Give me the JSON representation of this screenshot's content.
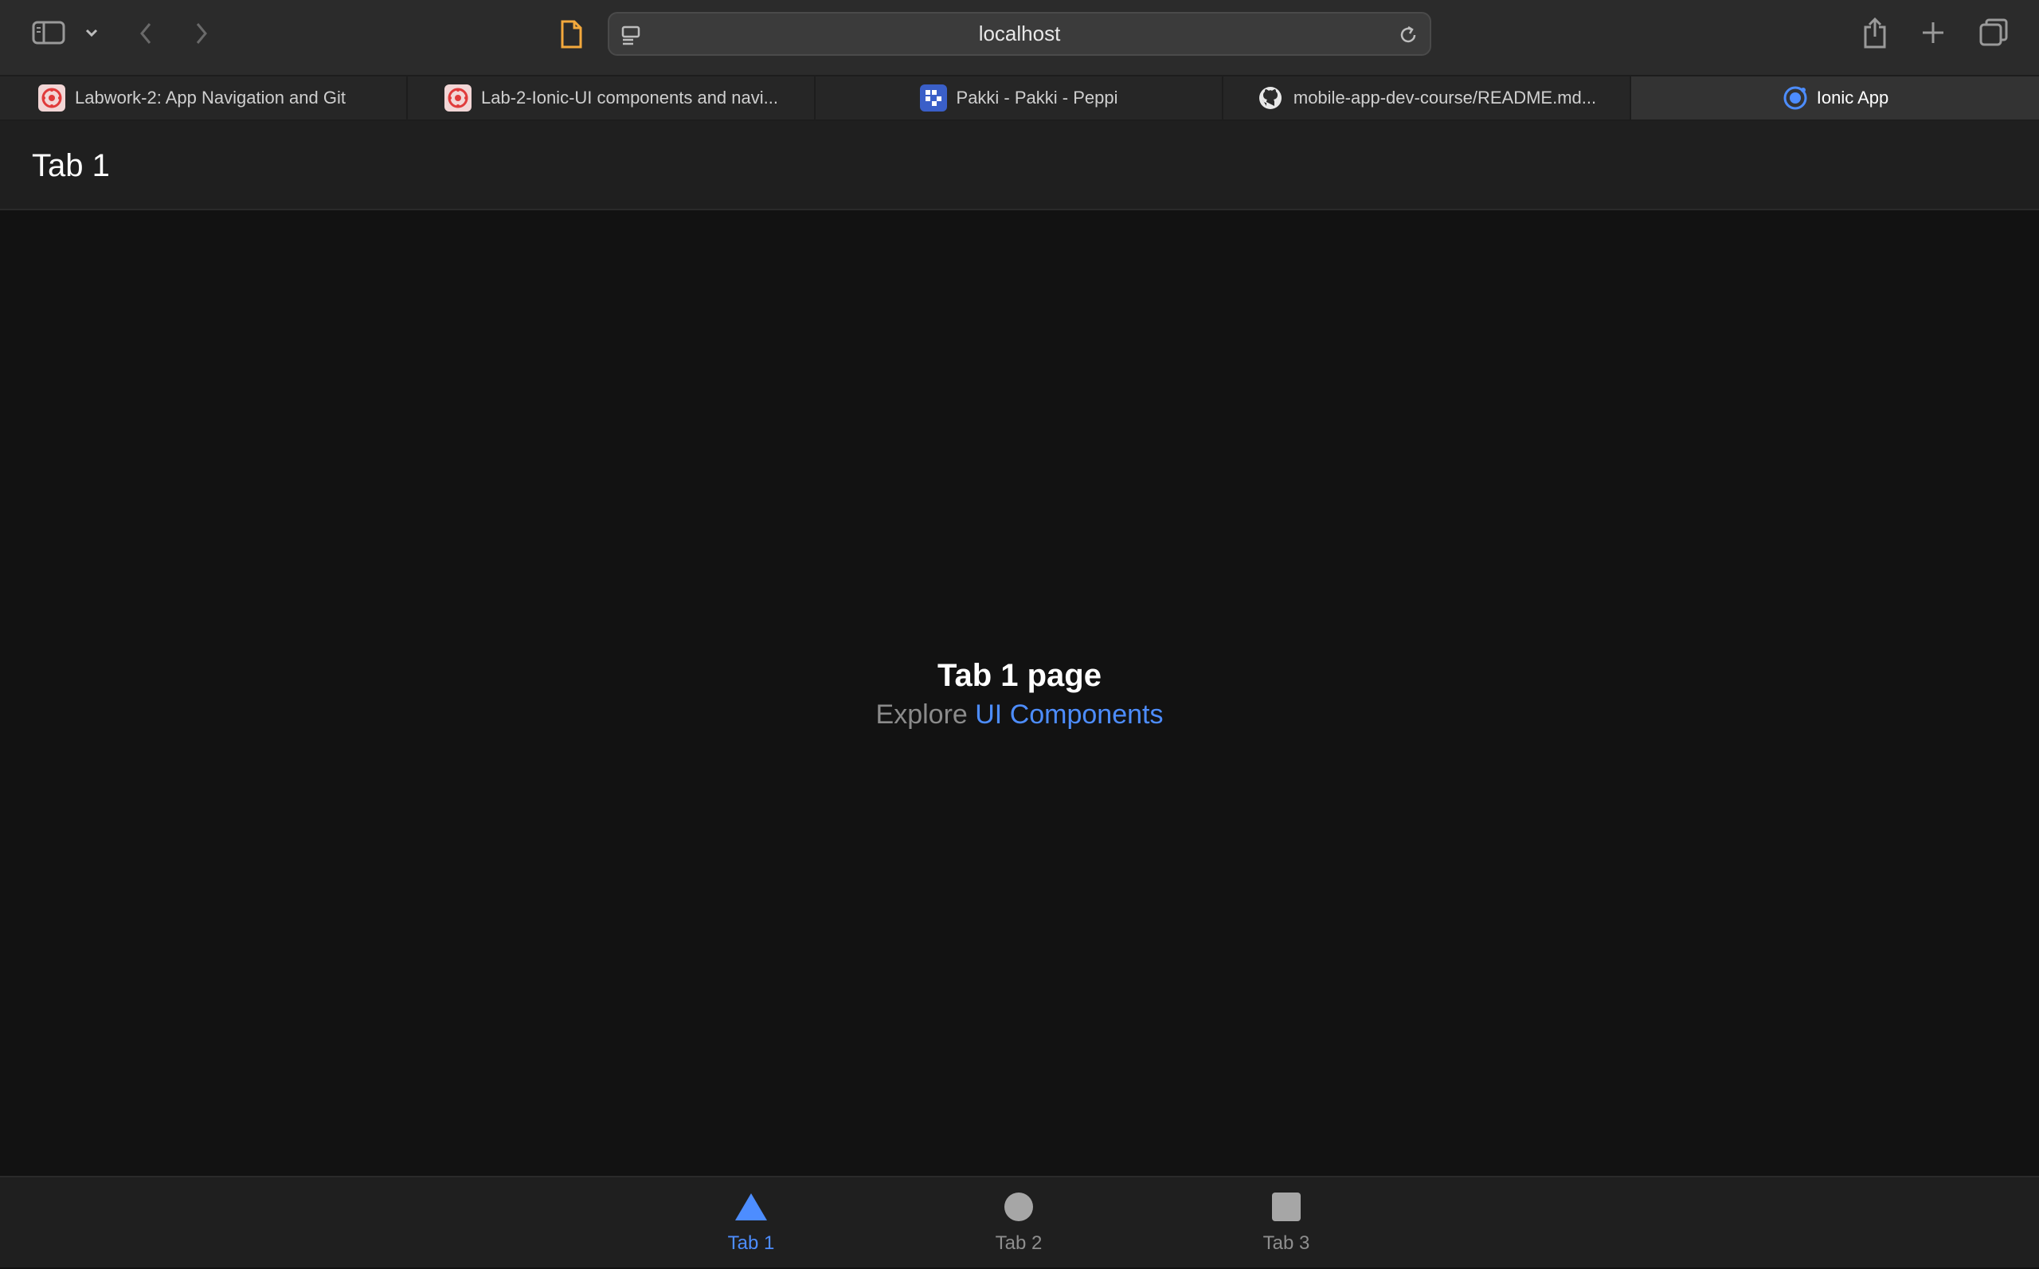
{
  "browser": {
    "address": "localhost",
    "tabs": [
      {
        "title": "Labwork-2: App Navigation and Git",
        "favicon": "canvas-icon"
      },
      {
        "title": "Lab-2-Ionic-UI components and navi...",
        "favicon": "canvas-icon"
      },
      {
        "title": "Pakki - Pakki - Peppi",
        "favicon": "peppi-icon"
      },
      {
        "title": "mobile-app-dev-course/README.md...",
        "favicon": "github-icon"
      },
      {
        "title": "Ionic App",
        "favicon": "ionic-icon",
        "active": true
      }
    ]
  },
  "app": {
    "header_title": "Tab 1",
    "page_heading": "Tab 1 page",
    "explore_prefix": "Explore",
    "explore_link": "UI Components",
    "accent_color": "#4d8dff",
    "tabbar": [
      {
        "label": "Tab 1",
        "icon": "triangle-icon",
        "selected": true
      },
      {
        "label": "Tab 2",
        "icon": "ellipse-icon",
        "selected": false
      },
      {
        "label": "Tab 3",
        "icon": "square-icon",
        "selected": false
      }
    ]
  }
}
